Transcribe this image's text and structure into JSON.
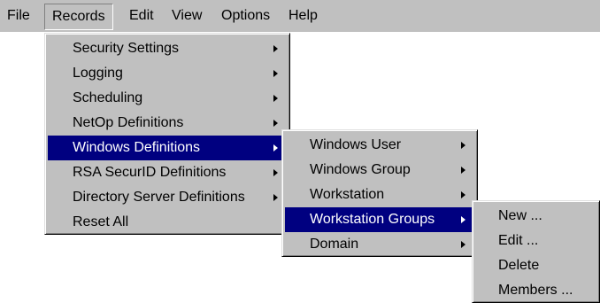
{
  "menubar": {
    "items": [
      {
        "label": "File"
      },
      {
        "label": "Records"
      },
      {
        "label": "Edit"
      },
      {
        "label": "View"
      },
      {
        "label": "Options"
      },
      {
        "label": "Help"
      }
    ]
  },
  "records_menu": {
    "items": [
      {
        "label": "Security Settings",
        "submenu": true
      },
      {
        "label": "Logging",
        "submenu": true
      },
      {
        "label": "Scheduling",
        "submenu": true
      },
      {
        "label": "NetOp Definitions",
        "submenu": true
      },
      {
        "label": "Windows Definitions",
        "submenu": true,
        "highlighted": true
      },
      {
        "label": "RSA SecurID Definitions",
        "submenu": true
      },
      {
        "label": "Directory Server Definitions",
        "submenu": true
      },
      {
        "label": "Reset All",
        "submenu": false
      }
    ]
  },
  "windows_definitions_menu": {
    "items": [
      {
        "label": "Windows User",
        "submenu": true
      },
      {
        "label": "Windows Group",
        "submenu": true
      },
      {
        "label": "Workstation",
        "submenu": true
      },
      {
        "label": "Workstation Groups",
        "submenu": true,
        "highlighted": true
      },
      {
        "label": "Domain",
        "submenu": true
      }
    ]
  },
  "workstation_groups_menu": {
    "items": [
      {
        "label": "New ..."
      },
      {
        "label": "Edit ..."
      },
      {
        "label": "Delete"
      },
      {
        "label": "Members ..."
      }
    ]
  },
  "colors": {
    "menu_face": "#c0c0c0",
    "highlight": "#000080",
    "highlight_text": "#ffffff"
  },
  "icons": {
    "submenu_arrow": "chevron-right-icon"
  }
}
